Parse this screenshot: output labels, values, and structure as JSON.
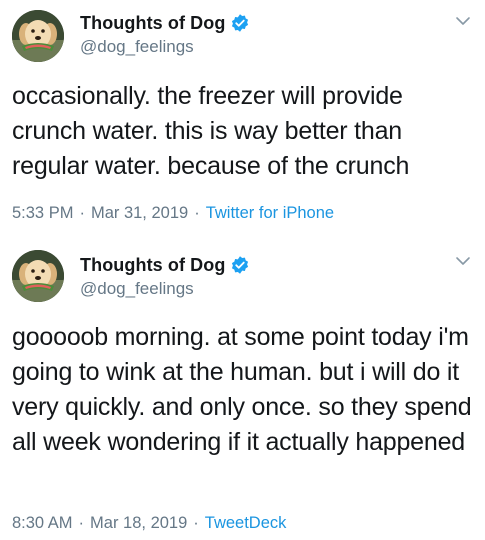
{
  "tweets": [
    {
      "author": {
        "display_name": "Thoughts of Dog",
        "handle": "@dog_feelings",
        "verified": true
      },
      "text": "occasionally. the freezer will provide crunch water. this is way better than regular water. because of the crunch",
      "time": "5:33 PM",
      "separator": "·",
      "date": "Mar 31, 2019",
      "source": "Twitter for iPhone"
    },
    {
      "author": {
        "display_name": "Thoughts of Dog",
        "handle": "@dog_feelings",
        "verified": true
      },
      "text": "gooooob morning. at some point today i'm going to wink at the human. but i will do it very quickly. and only once. so they spend all week wondering if it actually happened",
      "time": "8:30 AM",
      "separator": "·",
      "date": "Mar 18, 2019",
      "source": "TweetDeck"
    }
  ],
  "colors": {
    "text": "#14171a",
    "secondary": "#657786",
    "link": "#1b95e0",
    "verified": "#1da1f2"
  },
  "icons": [
    "avatar-dog",
    "verified-badge-icon",
    "chevron-down-icon"
  ]
}
